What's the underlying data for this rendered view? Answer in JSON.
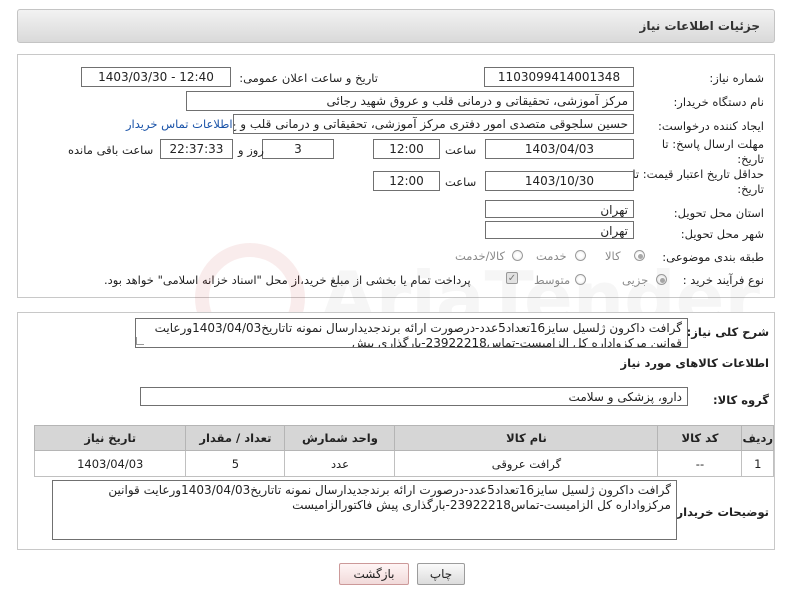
{
  "header": {
    "title": "جزئیات اطلاعات نیاز"
  },
  "form": {
    "need_number": {
      "label": "شماره نیاز:",
      "value": "1103099414001348"
    },
    "announce": {
      "label": "تاریخ و ساعت اعلان عمومی:",
      "value": "1403/03/30 - 12:40"
    },
    "buyer_org": {
      "label": "نام دستگاه خریدار:",
      "value": "مرکز آموزشی، تحقیقاتی و درمانی قلب و عروق شهید رجائی"
    },
    "creator": {
      "label": "ایجاد کننده درخواست:",
      "value": "حسین سلجوقی متصدی امور دفتری مرکز آموزشی، تحقیقاتی و درمانی قلب و ع",
      "link": "اطلاعات تماس خریدار"
    },
    "deadline": {
      "label_line1": "مهلت ارسال پاسخ: تا",
      "label_line2": "تاریخ:",
      "date": "1403/04/03",
      "time_label": "ساعت",
      "time": "12:00",
      "days": "3",
      "days_label": "روز و",
      "remaining": "22:37:33",
      "remaining_label": "ساعت باقی مانده"
    },
    "validity": {
      "label_line1": "حداقل تاریخ اعتبار قیمت: تا",
      "label_line2": "تاریخ:",
      "date": "1403/10/30",
      "time_label": "ساعت",
      "time": "12:00"
    },
    "province": {
      "label": "استان محل تحویل:",
      "value": "تهران"
    },
    "city": {
      "label": "شهر محل تحویل:",
      "value": "تهران"
    },
    "category": {
      "label": "طبقه بندی موضوعی:",
      "options": [
        "کالا",
        "خدمت",
        "کالا/خدمت"
      ],
      "selected": "کالا"
    },
    "purchase_type": {
      "label": "نوع فرآیند خرید :",
      "options": [
        "جزیی",
        "متوسط"
      ],
      "selected": "جزیی",
      "payment_note": "پرداخت تمام یا بخشی از مبلغ خرید،از محل \"اسناد خزانه اسلامی\" خواهد بود."
    }
  },
  "summary": {
    "label": "شرح کلی نیاز:",
    "text": "گرافت داکرون ژلسیل سایز16تعداد5عدد-درصورت ارائه برندجدیدارسال نمونه تاتاریخ1403/04/03ورعایت قوانین مرکزواداره کل الزامیست-تماس23922218-بارگذاری پیش"
  },
  "goods": {
    "section_title": "اطلاعات کالاهای مورد نیاز",
    "group_label": "گروه کالا:",
    "group_value": "دارو، پزشکی و سلامت",
    "table": {
      "headers": [
        "ردیف",
        "کد کالا",
        "نام کالا",
        "واحد شمارش",
        "تعداد / مقدار",
        "تاریخ نیاز"
      ],
      "rows": [
        [
          "1",
          "--",
          "گرافت عروقی",
          "عدد",
          "5",
          "1403/04/03"
        ]
      ]
    }
  },
  "buyer_notes": {
    "label": "توضیحات خریدار:",
    "text": "گرافت داکرون ژلسیل سایز16تعداد5عدد-درصورت ارائه برندجدیدارسال نمونه تاتاریخ1403/04/03ورعایت قوانین مرکزواداره کل الزامیست-تماس23922218-بارگذاری پیش فاکتورالزامیست"
  },
  "buttons": {
    "print": "چاپ",
    "back": "بازگشت"
  }
}
